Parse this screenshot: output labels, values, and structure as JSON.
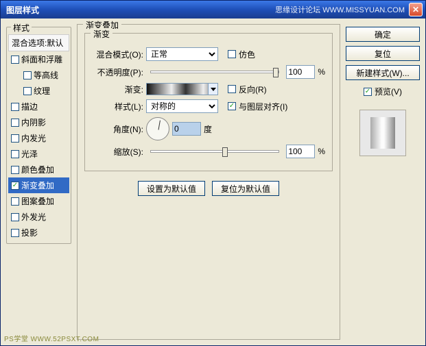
{
  "titlebar": {
    "title": "图层样式",
    "watermark": "思缘设计论坛  WWW.MISSYUAN.COM"
  },
  "left": {
    "group_title": "样式",
    "blend_default": "混合选项:默认",
    "items": [
      {
        "label": "斜面和浮雕",
        "checked": false,
        "indent": false
      },
      {
        "label": "等高线",
        "checked": false,
        "indent": true
      },
      {
        "label": "纹理",
        "checked": false,
        "indent": true
      },
      {
        "label": "描边",
        "checked": false,
        "indent": false
      },
      {
        "label": "内阴影",
        "checked": false,
        "indent": false
      },
      {
        "label": "内发光",
        "checked": false,
        "indent": false
      },
      {
        "label": "光泽",
        "checked": false,
        "indent": false
      },
      {
        "label": "颜色叠加",
        "checked": false,
        "indent": false
      },
      {
        "label": "渐变叠加",
        "checked": true,
        "indent": false,
        "selected": true
      },
      {
        "label": "图案叠加",
        "checked": false,
        "indent": false
      },
      {
        "label": "外发光",
        "checked": false,
        "indent": false
      },
      {
        "label": "投影",
        "checked": false,
        "indent": false
      }
    ]
  },
  "center": {
    "outer_title": "渐变叠加",
    "inner_title": "渐变",
    "labels": {
      "blend_mode": "混合模式(O):",
      "opacity": "不透明度(P):",
      "gradient": "渐变:",
      "style": "样式(L):",
      "angle": "角度(N):",
      "scale": "缩放(S):",
      "degree": "度",
      "percent": "%"
    },
    "values": {
      "blend_mode": "正常",
      "opacity": "100",
      "style": "对称的",
      "angle": "0",
      "scale": "100"
    },
    "checks": {
      "dither": "仿色",
      "dither_checked": false,
      "reverse": "反向(R)",
      "reverse_checked": false,
      "align": "与图层对齐(I)",
      "align_checked": true
    },
    "buttons": {
      "default": "设置为默认值",
      "reset": "复位为默认值"
    }
  },
  "right": {
    "ok": "确定",
    "cancel": "复位",
    "new_style": "新建样式(W)...",
    "preview": "预览(V)",
    "preview_checked": true
  },
  "footer_watermark": "PS学堂  WWW.52PSXT.COM"
}
